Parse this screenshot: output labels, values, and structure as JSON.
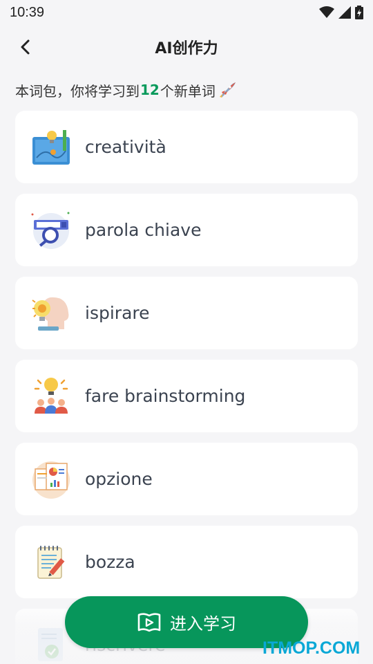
{
  "status_bar": {
    "time": "10:39"
  },
  "header": {
    "title": "AI创作力",
    "back_icon": "chevron-left-icon"
  },
  "intro": {
    "prefix": "本词包，你将学习到",
    "count": "12",
    "suffix": "个新单词",
    "icon": "rocket-icon"
  },
  "words": [
    {
      "text": "creatività",
      "icon": "blueprint-idea-icon"
    },
    {
      "text": "parola chiave",
      "icon": "search-keyword-icon"
    },
    {
      "text": "ispirare",
      "icon": "head-lightbulb-icon"
    },
    {
      "text": "fare brainstorming",
      "icon": "team-lightbulb-icon"
    },
    {
      "text": "opzione",
      "icon": "options-chart-icon"
    },
    {
      "text": "bozza",
      "icon": "notepad-pencil-icon"
    },
    {
      "text": "riscrivere",
      "icon": "document-check-icon"
    }
  ],
  "action": {
    "label": "进入学习",
    "icon": "book-play-icon",
    "color": "#07965b"
  },
  "accent_color": "#0a9a5c",
  "watermark": "ITMOP.COM"
}
